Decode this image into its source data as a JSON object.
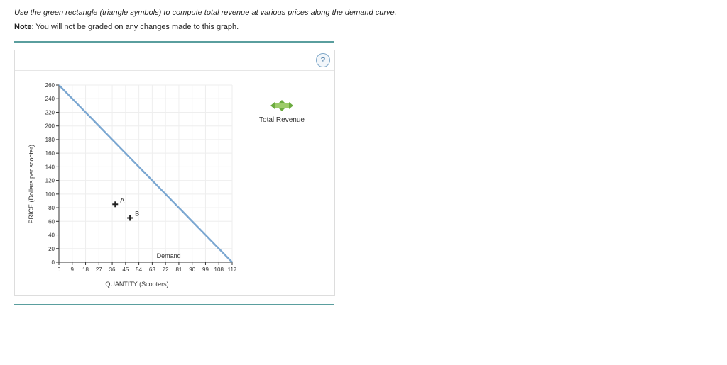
{
  "instructions": "Use the green rectangle (triangle symbols) to compute total revenue at various prices along the demand curve.",
  "note_label": "Note",
  "note_text": ": You will not be graded on any changes made to this graph.",
  "help_glyph": "?",
  "legend": {
    "total_revenue_label": "Total Revenue"
  },
  "chart_data": {
    "type": "line",
    "title": "",
    "xlabel": "QUANTITY (Scooters)",
    "ylabel": "PRICE (Dollars per scooter)",
    "xlim": [
      0,
      117
    ],
    "ylim": [
      0,
      260
    ],
    "x_ticks": [
      0,
      9,
      18,
      27,
      36,
      45,
      54,
      63,
      72,
      81,
      90,
      99,
      108,
      117
    ],
    "y_ticks": [
      0,
      20,
      40,
      60,
      80,
      100,
      120,
      140,
      160,
      180,
      200,
      220,
      240,
      260
    ],
    "series": [
      {
        "name": "Demand",
        "x": [
          0,
          117
        ],
        "y": [
          260,
          0
        ],
        "color": "#7ba7d1"
      }
    ],
    "markers": [
      {
        "label": "A",
        "x": 38,
        "y": 85,
        "symbol": "plus"
      },
      {
        "label": "B",
        "x": 48,
        "y": 65,
        "symbol": "plus"
      }
    ],
    "annotations": [
      {
        "text": "Demand",
        "x": 66,
        "y": 6
      }
    ]
  }
}
